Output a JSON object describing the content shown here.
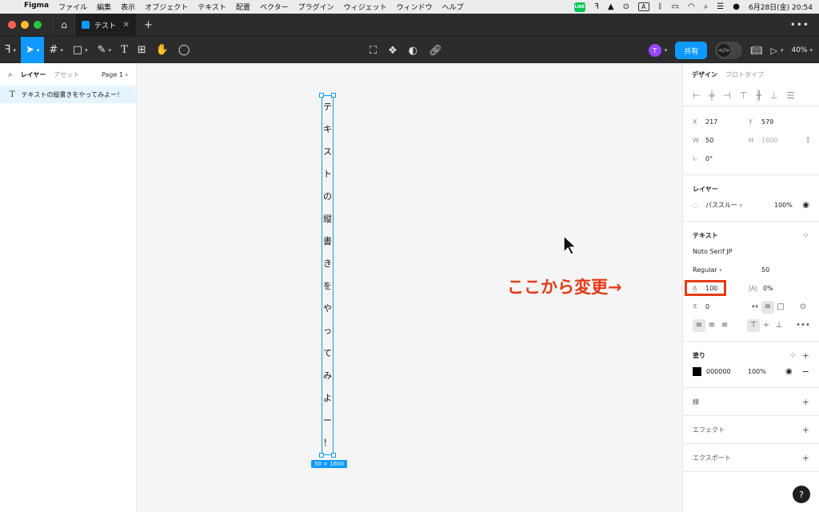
{
  "menubar": {
    "app_name": "Figma",
    "menus": [
      "ファイル",
      "編集",
      "表示",
      "オブジェクト",
      "テキスト",
      "配置",
      "ベクター",
      "プラグイン",
      "ウィジェット",
      "ウィンドウ",
      "ヘルプ"
    ],
    "line_label": "LINE",
    "ime": "A",
    "clock": "6月28日(金)  20:54"
  },
  "tabs": {
    "doc_title": "テスト"
  },
  "toolbar": {
    "avatar_initial": "T",
    "share_label": "共有",
    "devmode_label": "</>",
    "zoom_label": "40%"
  },
  "left_panel": {
    "tab_layers": "レイヤー",
    "tab_assets": "アセット",
    "page_label": "Page 1",
    "layer_name": "テキストの縦書きをやってみよー！"
  },
  "canvas": {
    "vertical_chars": [
      "テ",
      "キ",
      "ス",
      "ト",
      "の",
      "縦",
      "書",
      "き",
      "を",
      "や",
      "っ",
      "て",
      "み",
      "よ",
      "ー",
      "！"
    ],
    "dimension_label": "50 × 1600",
    "annotation": "ここから変更→",
    "annotation_color": "#e53a16",
    "selection_color": "#0d99ff"
  },
  "right_panel": {
    "tab_design": "デザイン",
    "tab_prototype": "プロトタイプ",
    "x_label": "X",
    "x_value": "217",
    "y_label": "Y",
    "y_value": "579",
    "w_label": "W",
    "w_value": "50",
    "h_label": "H",
    "h_value": "1600",
    "rotation": "0°",
    "layer_title": "レイヤー",
    "blend_mode": "パススルー",
    "layer_opacity": "100%",
    "text_title": "テキスト",
    "font_family": "Noto Serif JP",
    "font_style": "Regular",
    "font_size": "50",
    "line_height": "100",
    "letter_spacing": "0%",
    "paragraph_spacing": "0",
    "fill_title": "塗り",
    "fill_hex": "000000",
    "fill_opacity": "100%",
    "stroke_title": "線",
    "effects_title": "エフェクト",
    "export_title": "エクスポート",
    "help": "?"
  }
}
